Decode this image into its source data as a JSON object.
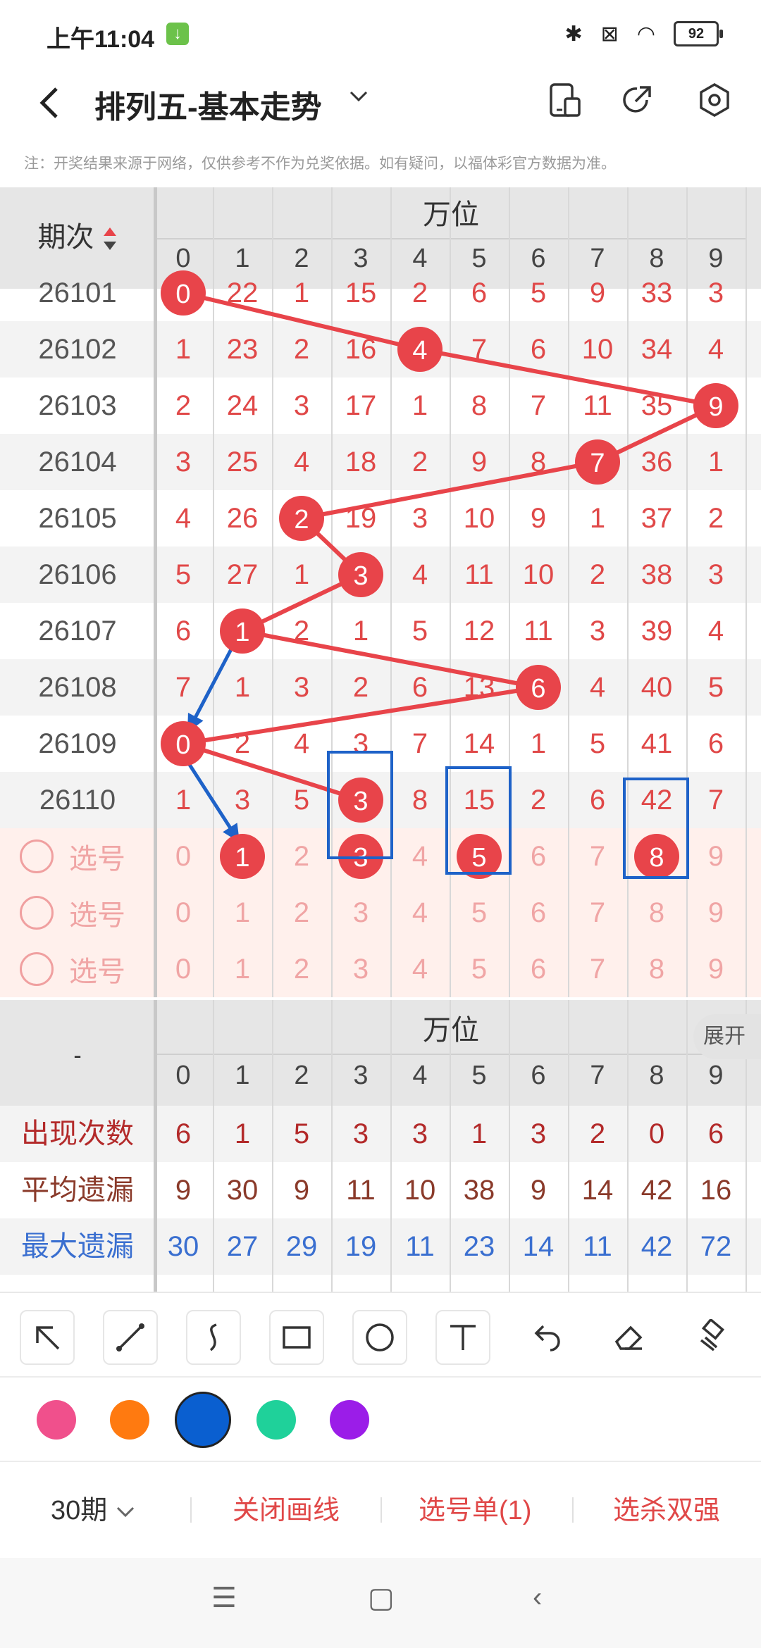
{
  "status": {
    "time": "上午11:04",
    "battery": "92"
  },
  "header": {
    "title": "排列五-基本走势"
  },
  "notice": "注：开奖结果来源于网络，仅供参考不作为兑奖依据。如有疑问，以福体彩官方数据为准。",
  "table": {
    "period_header": "期次",
    "group_label": "万位",
    "digits": [
      "0",
      "1",
      "2",
      "3",
      "4",
      "5",
      "6",
      "7",
      "8",
      "9"
    ],
    "rows": [
      {
        "period": "26101",
        "cells": [
          "0",
          "22",
          "1",
          "15",
          "2",
          "6",
          "5",
          "9",
          "33",
          "3"
        ],
        "hit": 0
      },
      {
        "period": "26102",
        "cells": [
          "1",
          "23",
          "2",
          "16",
          "4",
          "7",
          "6",
          "10",
          "34",
          "4"
        ],
        "hit": 4
      },
      {
        "period": "26103",
        "cells": [
          "2",
          "24",
          "3",
          "17",
          "1",
          "8",
          "7",
          "11",
          "35",
          "9"
        ],
        "hit": 9
      },
      {
        "period": "26104",
        "cells": [
          "3",
          "25",
          "4",
          "18",
          "2",
          "9",
          "8",
          "7",
          "36",
          "1"
        ],
        "hit": 7
      },
      {
        "period": "26105",
        "cells": [
          "4",
          "26",
          "2",
          "19",
          "3",
          "10",
          "9",
          "1",
          "37",
          "2"
        ],
        "hit": 2
      },
      {
        "period": "26106",
        "cells": [
          "5",
          "27",
          "1",
          "3",
          "4",
          "11",
          "10",
          "2",
          "38",
          "3"
        ],
        "hit": 3
      },
      {
        "period": "26107",
        "cells": [
          "6",
          "1",
          "2",
          "1",
          "5",
          "12",
          "11",
          "3",
          "39",
          "4"
        ],
        "hit": 1
      },
      {
        "period": "26108",
        "cells": [
          "7",
          "1",
          "3",
          "2",
          "6",
          "13",
          "6",
          "4",
          "40",
          "5"
        ],
        "hit": 6
      },
      {
        "period": "26109",
        "cells": [
          "0",
          "2",
          "4",
          "3",
          "7",
          "14",
          "1",
          "5",
          "41",
          "6"
        ],
        "hit": 0
      },
      {
        "period": "26110",
        "cells": [
          "1",
          "3",
          "5",
          "3",
          "8",
          "15",
          "2",
          "6",
          "42",
          "7"
        ],
        "hit": 3
      }
    ],
    "pick_rows": [
      {
        "label": "选号",
        "cells": [
          "0",
          "1",
          "2",
          "3",
          "4",
          "5",
          "6",
          "7",
          "8",
          "9"
        ],
        "picked": [
          1,
          3,
          5,
          8
        ]
      },
      {
        "label": "选号",
        "cells": [
          "0",
          "1",
          "2",
          "3",
          "4",
          "5",
          "6",
          "7",
          "8",
          "9"
        ],
        "picked": []
      },
      {
        "label": "选号",
        "cells": [
          "0",
          "1",
          "2",
          "3",
          "4",
          "5",
          "6",
          "7",
          "8",
          "9"
        ],
        "picked": []
      }
    ]
  },
  "stats": {
    "left_label": "-",
    "group_label": "万位",
    "expand": "展开",
    "rows": [
      {
        "label": "出现次数",
        "color": "#b32a2a",
        "values": [
          "6",
          "1",
          "5",
          "3",
          "3",
          "1",
          "3",
          "2",
          "0",
          "6"
        ]
      },
      {
        "label": "平均遗漏",
        "color": "#8a3a2a",
        "values": [
          "9",
          "30",
          "9",
          "11",
          "10",
          "38",
          "9",
          "14",
          "42",
          "16"
        ]
      },
      {
        "label": "最大遗漏",
        "color": "#3a6fd0",
        "values": [
          "30",
          "27",
          "29",
          "19",
          "11",
          "23",
          "14",
          "11",
          "42",
          "72"
        ]
      }
    ]
  },
  "tools": [
    "arrow-tool-icon",
    "line-tool-icon",
    "curve-tool-icon",
    "rectangle-tool-icon",
    "circle-tool-icon",
    "text-tool-icon",
    "undo-icon",
    "eraser-icon",
    "clear-icon"
  ],
  "colors": [
    "#f0508c",
    "#ff7a10",
    "#0a5fd0",
    "#1fd19a",
    "#9b1de8"
  ],
  "bottom": {
    "periods": "30期",
    "close_draw": "关闭画线",
    "pick_list": "选号单(1)",
    "kill": "选杀双强"
  },
  "accent": "#e8444a",
  "draw_color": "#1e62c8"
}
